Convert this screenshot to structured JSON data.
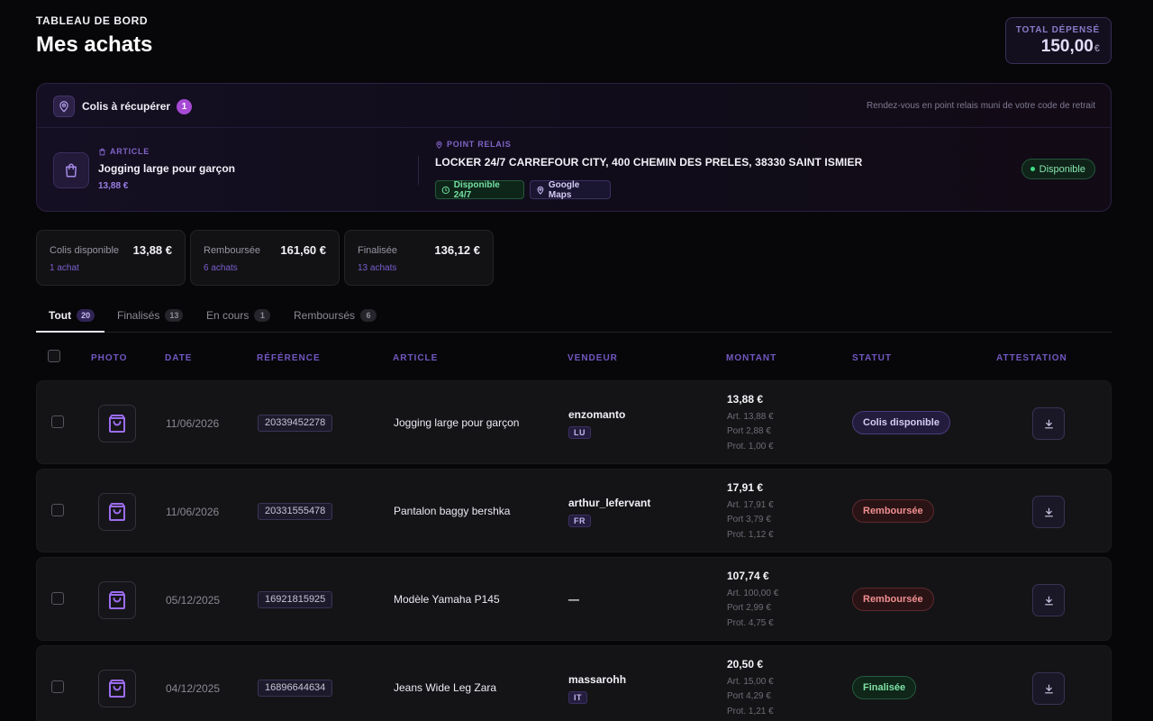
{
  "header": {
    "eyebrow": "TABLEAU DE BORD",
    "title": "Mes achats",
    "total_label": "TOTAL DÉPENSÉ",
    "total_value": "150,00",
    "total_currency": "€"
  },
  "pickup": {
    "title": "Colis à récupérer",
    "count": "1",
    "hint": "Rendez-vous en point relais muni de votre code de retrait",
    "article_label": "ARTICLE",
    "article_name": "Jogging large pour garçon",
    "article_price": "13,88 €",
    "relay_label": "POINT RELAIS",
    "relay_address": "LOCKER 24/7 CARREFOUR CITY, 400 CHEMIN DES PRELES, 38330 SAINT ISMIER",
    "chip_hours": "Disponible 24/7",
    "chip_maps": "Google Maps",
    "status": "Disponible"
  },
  "stats": [
    {
      "label": "Colis disponible",
      "value": "13,88 €",
      "sub": "1 achat"
    },
    {
      "label": "Remboursée",
      "value": "161,60 €",
      "sub": "6 achats"
    },
    {
      "label": "Finalisée",
      "value": "136,12 €",
      "sub": "13 achats"
    }
  ],
  "tabs": [
    {
      "label": "Tout",
      "count": "20"
    },
    {
      "label": "Finalisés",
      "count": "13"
    },
    {
      "label": "En cours",
      "count": "1"
    },
    {
      "label": "Remboursés",
      "count": "6"
    }
  ],
  "columns": {
    "photo": "PHOTO",
    "date": "DATE",
    "reference": "RÉFÉRENCE",
    "article": "ARTICLE",
    "seller": "VENDEUR",
    "amount": "MONTANT",
    "status": "STATUT",
    "certificate": "ATTESTATION"
  },
  "rows": [
    {
      "date": "11/06/2026",
      "ref": "20339452278",
      "article": "Jogging large pour garçon",
      "seller": "enzomanto",
      "country": "LU",
      "amount": "13,88 €",
      "art": "Art. 13,88 €",
      "port": "Port 2,88 €",
      "prot": "Prot. 1,00 €",
      "status": "Colis disponible"
    },
    {
      "date": "11/06/2026",
      "ref": "20331555478",
      "article": "Pantalon baggy bershka",
      "seller": "arthur_lefervant",
      "country": "FR",
      "amount": "17,91 €",
      "art": "Art. 17,91 €",
      "port": "Port 3,79 €",
      "prot": "Prot. 1,12 €",
      "status": "Remboursée"
    },
    {
      "date": "05/12/2025",
      "ref": "16921815925",
      "article": "Modèle Yamaha P145",
      "seller": "—",
      "country": "",
      "amount": "107,74 €",
      "art": "Art. 100,00 €",
      "port": "Port 2,99 €",
      "prot": "Prot. 4,75 €",
      "status": "Remboursée"
    },
    {
      "date": "04/12/2025",
      "ref": "16896644634",
      "article": "Jeans Wide Leg Zara",
      "seller": "massarohh",
      "country": "IT",
      "amount": "20,50 €",
      "art": "Art. 15,00 €",
      "port": "Port 4,29 €",
      "prot": "Prot. 1,21 €",
      "status": "Finalisée"
    }
  ],
  "colors": {
    "accent": "#7257c2",
    "status_available": "#7fe3a5",
    "status_refunded": "#f08f8f",
    "badge": "#a64ad6"
  }
}
